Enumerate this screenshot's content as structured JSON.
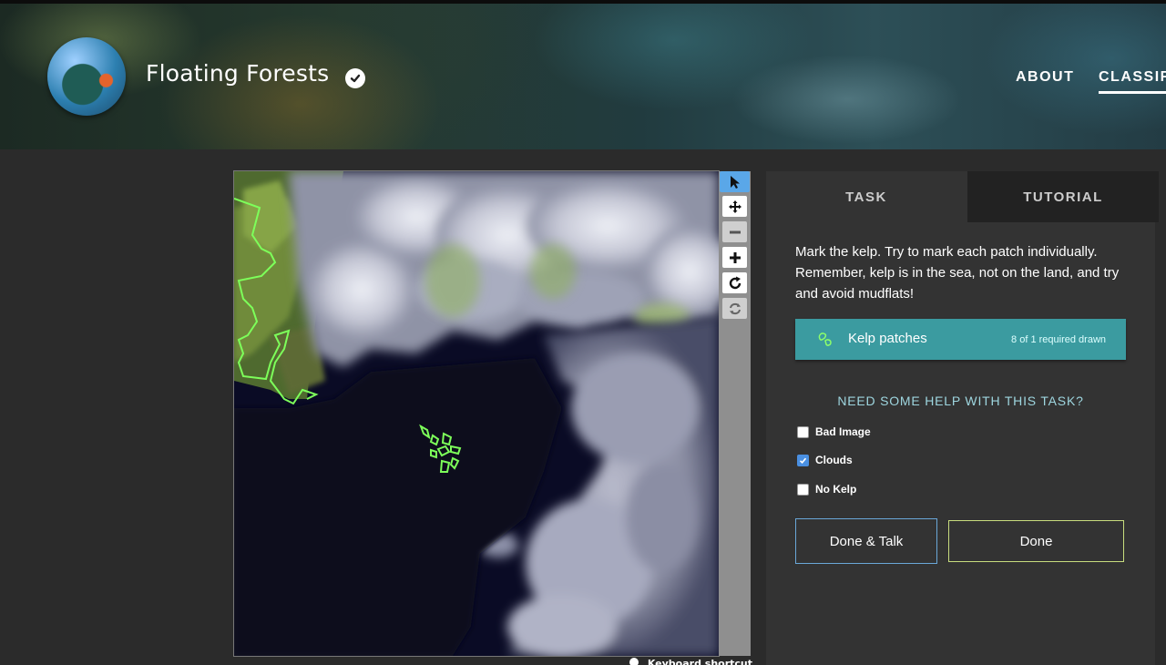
{
  "project": {
    "title": "Floating Forests",
    "logo_icon": "earth-globe-logo",
    "verified_icon": "check-circle-icon"
  },
  "nav": {
    "about": "ABOUT",
    "classify": "CLASSIFY"
  },
  "subject": {
    "kelp_outline_color": "#7dff5a",
    "map_hint": "Keyboard shortcuts"
  },
  "toolbar": {
    "tools": [
      "pointer-icon",
      "pan-icon",
      "zoom-out-icon",
      "zoom-in-icon",
      "rotate-icon",
      "reset-icon"
    ],
    "active_tool": "pointer-icon"
  },
  "panel": {
    "tabs": {
      "task": "TASK",
      "tutorial": "TUTORIAL"
    },
    "active_tab": "TASK",
    "instructions": "Mark the kelp. Try to mark each patch individually. Remember, kelp is in the sea, not on the land, and try and avoid mudflats!",
    "tool": {
      "label": "Kelp patches",
      "count": "8 of 1 required drawn",
      "icon": "kelp-outline-icon",
      "color": "#3b9ba0"
    },
    "help_title": "NEED SOME HELP WITH THIS TASK?",
    "options": [
      {
        "label": "Bad Image",
        "checked": false
      },
      {
        "label": "Clouds",
        "checked": true
      },
      {
        "label": "No Kelp",
        "checked": false
      }
    ],
    "buttons": {
      "talk": "Done & Talk",
      "done": "Done"
    }
  }
}
